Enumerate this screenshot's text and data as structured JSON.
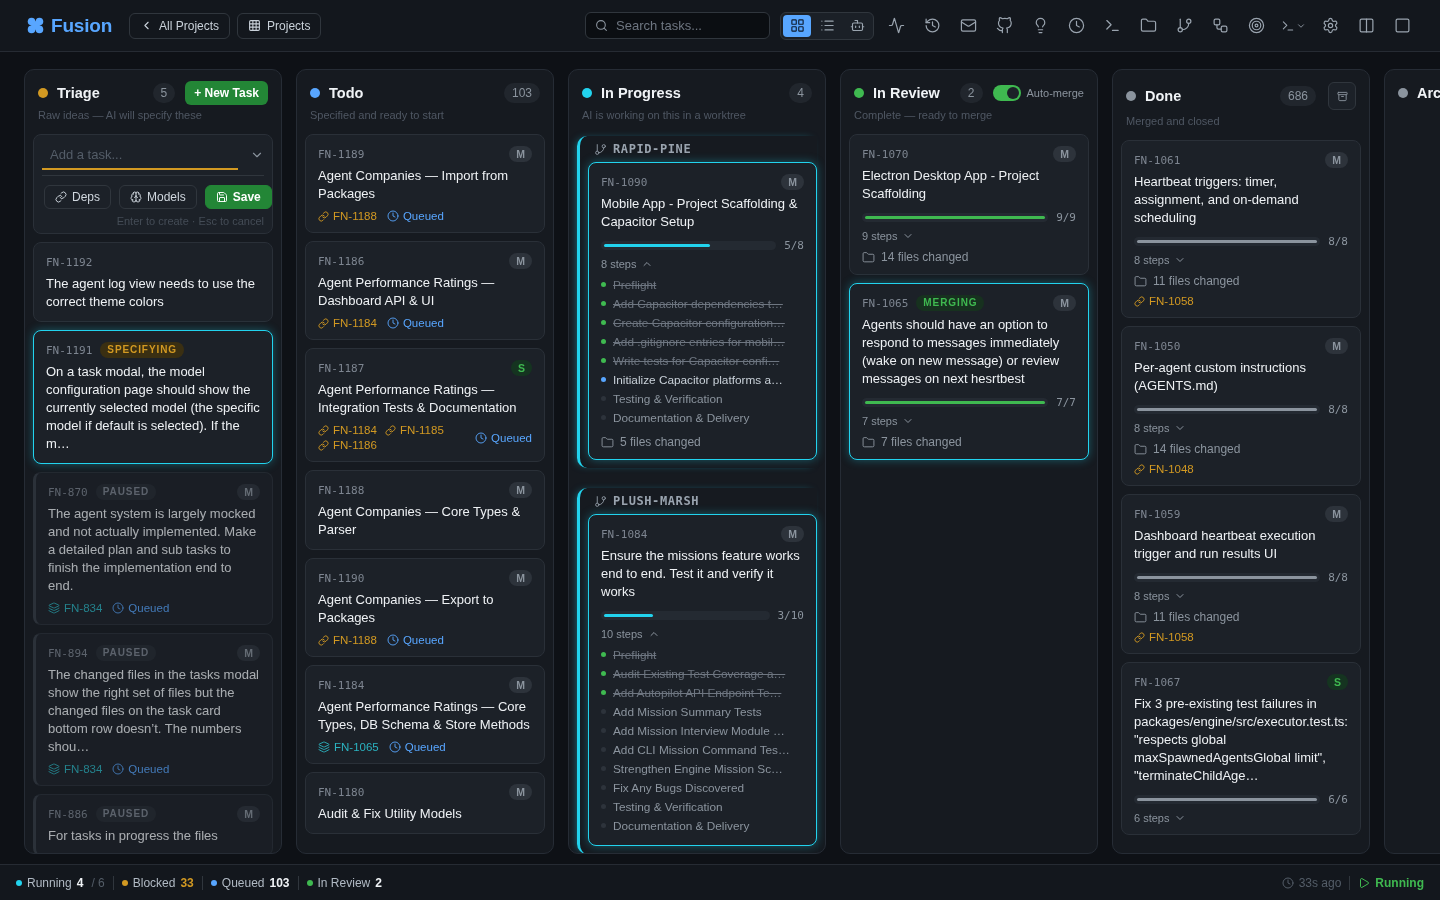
{
  "header": {
    "logo": "Fusion",
    "nav": [
      {
        "kind": "back",
        "label": "All Projects"
      },
      {
        "kind": "projects",
        "label": "Projects"
      }
    ],
    "search": {
      "placeholder": "Search tasks..."
    },
    "view_modes": [
      {
        "kind": "board",
        "selected": true
      },
      {
        "kind": "list",
        "selected": false
      },
      {
        "kind": "agents",
        "selected": false
      }
    ]
  },
  "columns": [
    {
      "kind": "triage",
      "title": "Triage",
      "color": "#d29922",
      "count": "5",
      "action": "+ New Task",
      "subtitle": "Raw ideas — AI will specify these",
      "composer": {
        "placeholder": "Add a task...",
        "buttons": [
          {
            "kind": "deps",
            "label": "Deps"
          },
          {
            "kind": "models",
            "label": "Models"
          },
          {
            "kind": "save",
            "label": "Save"
          }
        ],
        "hint": "Enter to create · Esc to cancel"
      },
      "cards": [
        {
          "id": "FN-1192",
          "highlighted": false,
          "title": "The agent log view needs to use the correct theme colors"
        },
        {
          "id": "FN-1191",
          "badge": {
            "label": "SPECIFYING",
            "kind": "specifying"
          },
          "highlighted": true,
          "title": "On a task modal, the model configuration page should show the currently selected model (the specific model if default is selected). If the m…"
        },
        {
          "id": "FN-870",
          "badge": {
            "label": "PAUSED",
            "kind": "paused"
          },
          "size": {
            "label": "M",
            "kind": "medium"
          },
          "highlighted": false,
          "title": "The agent system is largely mocked and not actually implemented. Make a detailed plan and sub tasks to finish the implementation end to end.",
          "links": [
            {
              "kind": "parent",
              "label": "FN-834"
            }
          ],
          "queue": "Queued"
        },
        {
          "id": "FN-894",
          "badge": {
            "label": "PAUSED",
            "kind": "paused"
          },
          "size": {
            "label": "M",
            "kind": "medium"
          },
          "highlighted": false,
          "title": "The changed files in the tasks modal show the right set of files but the changed files on the task card bottom row doesn’t. The numbers shou…",
          "links": [
            {
              "kind": "parent",
              "label": "FN-834"
            }
          ],
          "queue": "Queued"
        },
        {
          "id": "FN-886",
          "badge": {
            "label": "PAUSED",
            "kind": "paused"
          },
          "size": {
            "label": "M",
            "kind": "medium"
          },
          "highlighted": false,
          "title": "For tasks in progress the files"
        }
      ]
    },
    {
      "kind": "todo",
      "title": "Todo",
      "color": "#58a6ff",
      "count": "103",
      "subtitle": "Specified and ready to start",
      "cards": [
        {
          "id": "FN-1189",
          "size": {
            "label": "M",
            "kind": "medium"
          },
          "highlighted": false,
          "title": "Agent Companies — Import from Packages",
          "links": [
            {
              "kind": "dependency",
              "label": "FN-1188"
            }
          ],
          "queue": "Queued"
        },
        {
          "id": "FN-1186",
          "size": {
            "label": "M",
            "kind": "medium"
          },
          "highlighted": false,
          "title": "Agent Performance Ratings — Dashboard API & UI",
          "links": [
            {
              "kind": "dependency",
              "label": "FN-1184"
            }
          ],
          "queue": "Queued"
        },
        {
          "id": "FN-1187",
          "size": {
            "label": "S",
            "kind": "small"
          },
          "highlighted": false,
          "title": "Agent Performance Ratings — Integration Tests & Documentation",
          "links": [
            {
              "kind": "dependency",
              "label": "FN-1184"
            },
            {
              "kind": "dependency",
              "label": "FN-1185"
            },
            {
              "kind": "dependency",
              "label": "FN-1186"
            }
          ],
          "queue": "Queued"
        },
        {
          "id": "FN-1188",
          "size": {
            "label": "M",
            "kind": "medium"
          },
          "highlighted": false,
          "title": "Agent Companies — Core Types & Parser"
        },
        {
          "id": "FN-1190",
          "size": {
            "label": "M",
            "kind": "medium"
          },
          "highlighted": false,
          "title": "Agent Companies — Export to Packages",
          "links": [
            {
              "kind": "dependency",
              "label": "FN-1188"
            }
          ],
          "queue": "Queued"
        },
        {
          "id": "FN-1184",
          "size": {
            "label": "M",
            "kind": "medium"
          },
          "highlighted": false,
          "title": "Agent Performance Ratings — Core Types, DB Schema & Store Methods",
          "links": [
            {
              "kind": "parent",
              "label": "FN-1065"
            }
          ],
          "queue": "Queued"
        },
        {
          "id": "FN-1180",
          "size": {
            "label": "M",
            "kind": "medium"
          },
          "highlighted": false,
          "title": "Audit & Fix Utility Models"
        }
      ]
    },
    {
      "kind": "in_progress",
      "title": "In Progress",
      "color": "#22d3ee",
      "count": "4",
      "subtitle": "AI is working on this in a worktree",
      "groups": [
        {
          "worktree": "RAPID-PINE",
          "card": {
            "id": "FN-1090",
            "size": {
              "label": "M",
              "kind": "medium"
            },
            "highlighted": true,
            "title": "Mobile App - Project Scaffolding & Capacitor Setup",
            "progress": {
              "level": 0.625,
              "reading": "5/8"
            },
            "steps": {
              "label": "8 steps",
              "expanded": true,
              "items": [
                {
                  "text": "Preflight",
                  "kind": "done"
                },
                {
                  "text": "Add Capacitor dependencies t…",
                  "kind": "done"
                },
                {
                  "text": "Create Capacitor configuration…",
                  "kind": "done"
                },
                {
                  "text": "Add .gitignore entries for mobil…",
                  "kind": "done"
                },
                {
                  "text": "Write tests for Capacitor confi…",
                  "kind": "done"
                },
                {
                  "text": "Initialize Capacitor platforms a…",
                  "kind": "active"
                },
                {
                  "text": "Testing & Verification",
                  "kind": "pending"
                },
                {
                  "text": "Documentation & Delivery",
                  "kind": "pending"
                }
              ]
            },
            "files": "5 files changed"
          }
        },
        {
          "worktree": "PLUSH-MARSH",
          "card": {
            "id": "FN-1084",
            "size": {
              "label": "M",
              "kind": "medium"
            },
            "highlighted": true,
            "title": "Ensure the missions feature works end to end. Test it and verify it works",
            "progress": {
              "level": 0.3,
              "reading": "3/10"
            },
            "steps": {
              "label": "10 steps",
              "expanded": true,
              "items": [
                {
                  "text": "Preflight",
                  "kind": "done"
                },
                {
                  "text": "Audit Existing Test Coverage a…",
                  "kind": "done"
                },
                {
                  "text": "Add Autopilot API Endpoint Te…",
                  "kind": "done"
                },
                {
                  "text": "Add Mission Summary Tests",
                  "kind": "pending"
                },
                {
                  "text": "Add Mission Interview Module …",
                  "kind": "pending"
                },
                {
                  "text": "Add CLI Mission Command Tes…",
                  "kind": "pending"
                },
                {
                  "text": "Strengthen Engine Mission Sc…",
                  "kind": "pending"
                },
                {
                  "text": "Fix Any Bugs Discovered",
                  "kind": "pending"
                },
                {
                  "text": "Testing & Verification",
                  "kind": "pending"
                },
                {
                  "text": "Documentation & Delivery",
                  "kind": "pending"
                }
              ]
            }
          }
        }
      ]
    },
    {
      "kind": "in_review",
      "title": "In Review",
      "color": "#3fb950",
      "count": "2",
      "toggle": {
        "label": "Auto-merge",
        "on": true
      },
      "subtitle": "Complete — ready to merge",
      "cards": [
        {
          "id": "FN-1070",
          "size": {
            "label": "M",
            "kind": "medium"
          },
          "highlighted": false,
          "title": "Electron Desktop App - Project Scaffolding",
          "progress": {
            "level": 1,
            "reading": "9/9"
          },
          "steps": {
            "label": "9 steps",
            "expanded": false
          },
          "files": "14 files changed"
        },
        {
          "id": "FN-1065",
          "badge": {
            "label": "MERGING",
            "kind": "merging"
          },
          "size": {
            "label": "M",
            "kind": "medium"
          },
          "highlighted": true,
          "title": "Agents should have an option to respond to messages immediately (wake on new message) or review messages on next hesrtbest",
          "progress": {
            "level": 1,
            "reading": "7/7"
          },
          "steps": {
            "label": "7 steps",
            "expanded": false
          },
          "files": "7 files changed"
        }
      ]
    },
    {
      "kind": "done",
      "title": "Done",
      "color": "#8b949e",
      "count": "686",
      "subtitle": "Merged and closed",
      "cards": [
        {
          "id": "FN-1061",
          "size": {
            "label": "M",
            "kind": "medium"
          },
          "highlighted": false,
          "title": "Heartbeat triggers: timer, assignment, and on-demand scheduling",
          "progress": {
            "level": 1,
            "reading": "8/8"
          },
          "steps": {
            "label": "8 steps",
            "expanded": false
          },
          "files": "11 files changed",
          "links": [
            {
              "kind": "dependency",
              "label": "FN-1058"
            }
          ]
        },
        {
          "id": "FN-1050",
          "size": {
            "label": "M",
            "kind": "medium"
          },
          "highlighted": false,
          "title": "Per-agent custom instructions (AGENTS.md)",
          "progress": {
            "level": 1,
            "reading": "8/8"
          },
          "steps": {
            "label": "8 steps",
            "expanded": false
          },
          "files": "14 files changed",
          "links": [
            {
              "kind": "dependency",
              "label": "FN-1048"
            }
          ]
        },
        {
          "id": "FN-1059",
          "size": {
            "label": "M",
            "kind": "medium"
          },
          "highlighted": false,
          "title": "Dashboard heartbeat execution trigger and run results UI",
          "progress": {
            "level": 1,
            "reading": "8/8"
          },
          "steps": {
            "label": "8 steps",
            "expanded": false
          },
          "files": "11 files changed",
          "links": [
            {
              "kind": "dependency",
              "label": "FN-1058"
            }
          ]
        },
        {
          "id": "FN-1067",
          "size": {
            "label": "S",
            "kind": "small"
          },
          "highlighted": false,
          "title": "Fix 3 pre-existing test failures in packages/engine/src/executor.test.ts: \"respects global maxSpawnedAgentsGlobal limit\", \"terminateChildAge…",
          "progress": {
            "level": 1,
            "reading": "6/6"
          },
          "steps": {
            "label": "6 steps",
            "expanded": false
          }
        }
      ]
    },
    {
      "kind": "archive",
      "title": "Arc",
      "color": "#8b949e"
    }
  ],
  "status_bar": {
    "items": [
      {
        "label": "Running",
        "value": "4",
        "total": "/ 6",
        "color": "#22d3ee",
        "alert": false
      },
      {
        "label": "Blocked",
        "value": "33",
        "color": "#d29922",
        "alert": true
      },
      {
        "label": "Queued",
        "value": "103",
        "color": "#58a6ff",
        "alert": false
      },
      {
        "label": "In Review",
        "value": "2",
        "color": "#3fb950",
        "alert": false
      }
    ],
    "updated": "33s ago",
    "engine": "Running"
  }
}
